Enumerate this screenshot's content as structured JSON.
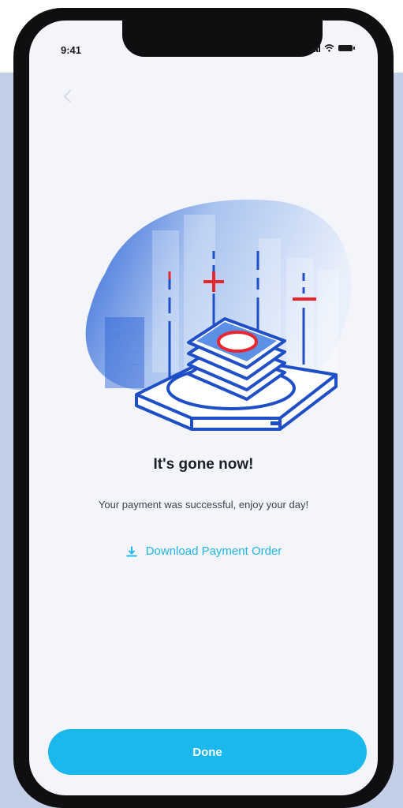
{
  "status_bar": {
    "time": "9:41",
    "icons": [
      "signal-icon",
      "wifi-icon",
      "battery-icon"
    ]
  },
  "illustration": {
    "icon": "payment-success-illustration",
    "colors": {
      "primary": "#1f4fc7",
      "accent": "#e8262f",
      "blob": "#c4d6f3"
    }
  },
  "message": {
    "title": "It's gone now!",
    "subtitle": "Your payment was successful, enjoy your day!"
  },
  "download": {
    "label": "Download Payment Order",
    "icon": "download-icon",
    "color": "#22b6ea"
  },
  "done_button": {
    "label": "Done",
    "color": "#1ab8ec"
  }
}
